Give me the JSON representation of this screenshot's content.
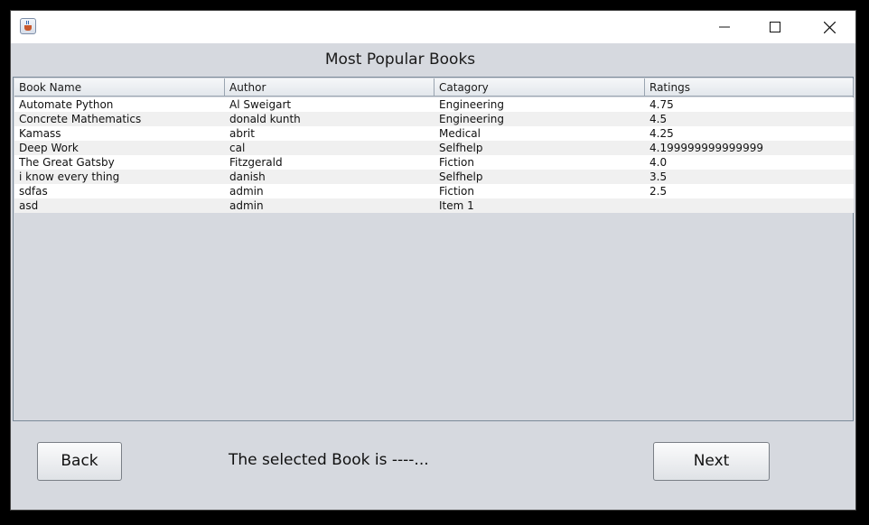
{
  "titlebar": {
    "icon": "java-cup-icon",
    "controls": [
      "minimize-icon",
      "maximize-icon",
      "close-icon"
    ]
  },
  "heading": "Most Popular Books",
  "table": {
    "columns": [
      "Book Name",
      "Author",
      "Catagory",
      "Ratings"
    ],
    "rows": [
      [
        "Automate  Python",
        "Al Sweigart",
        "Engineering",
        "4.75"
      ],
      [
        "Concrete Mathematics",
        "donald kunth",
        "Engineering",
        "4.5"
      ],
      [
        "Kamass",
        "abrit",
        "Medical",
        "4.25"
      ],
      [
        "Deep Work",
        "cal",
        "Selfhelp",
        "4.199999999999999"
      ],
      [
        "The Great Gatsby",
        "Fitzgerald",
        "Fiction",
        "4.0"
      ],
      [
        "i know every thing",
        "danish",
        "Selfhelp",
        "3.5"
      ],
      [
        "sdfas",
        "admin",
        "Fiction",
        "2.5"
      ],
      [
        "asd",
        "admin",
        "Item 1",
        ""
      ]
    ]
  },
  "footer": {
    "back_label": "Back",
    "selected_text": "The selected Book is ----...",
    "next_label": "Next"
  }
}
